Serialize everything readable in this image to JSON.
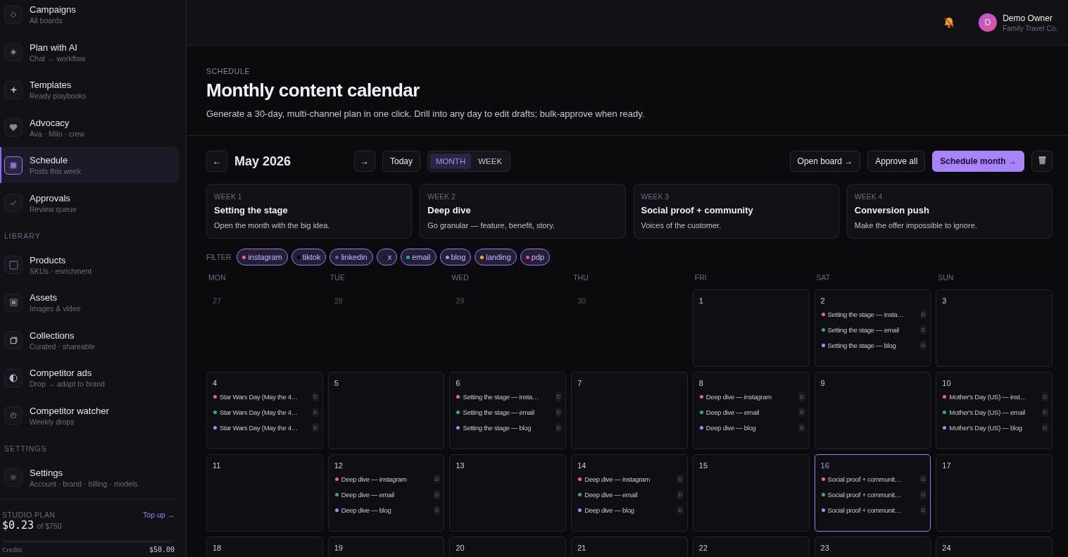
{
  "sidebar": {
    "groups": [
      {
        "items": [
          {
            "label": "Campaigns",
            "sub": "All boards",
            "selected": false
          },
          {
            "label": "Plan with AI",
            "sub": "Chat → workflow",
            "selected": false
          },
          {
            "label": "Templates",
            "sub": "Ready playbooks",
            "selected": false
          },
          {
            "label": "Advocacy",
            "sub": "Ava · Milo · crew",
            "selected": false
          },
          {
            "label": "Schedule",
            "sub": "Posts this week",
            "selected": true
          },
          {
            "label": "Approvals",
            "sub": "Review queue",
            "selected": false
          }
        ]
      },
      {
        "heading": "LIBRARY",
        "items": [
          {
            "label": "Products",
            "sub": "SKUs · enrichment",
            "selected": false
          },
          {
            "label": "Assets",
            "sub": "Images & video",
            "selected": false
          },
          {
            "label": "Collections",
            "sub": "Curated · shareable",
            "selected": false
          },
          {
            "label": "Competitor ads",
            "sub": "Drop → adapt to brand",
            "selected": false
          },
          {
            "label": "Competitor watcher",
            "sub": "Weekly drops",
            "selected": false
          }
        ]
      },
      {
        "heading": "SETTINGS",
        "items": [
          {
            "label": "Settings",
            "sub": "Account · brand · billing · models",
            "selected": false
          }
        ]
      }
    ],
    "plan": {
      "label": "STUDIO PLAN",
      "link": "Top up →",
      "amount": "$0.23",
      "of": "of $750",
      "level": 0.0003,
      "credits_label": "Credits",
      "credits_value": "$50.00"
    }
  },
  "topbar": {
    "user": {
      "initial": "D",
      "name": "Demo Owner",
      "org": "Family Travel Co."
    }
  },
  "header": {
    "eyebrow": "SCHEDULE",
    "title": "Monthly content calendar",
    "description": "Generate a 30-day, multi-channel plan in one click. Drill into any day to edit drafts; bulk-approve when ready."
  },
  "toolbar": {
    "prev": "←",
    "month": "May 2026",
    "next": "→",
    "today": "Today",
    "views": [
      {
        "label": "MONTH",
        "selected": true
      },
      {
        "label": "WEEK",
        "selected": false
      }
    ],
    "actions": [
      {
        "label": "Open board →",
        "kind": "secondary"
      },
      {
        "label": "Approve all",
        "kind": "secondary"
      },
      {
        "label": "Schedule month →",
        "kind": "primary"
      }
    ]
  },
  "weeks": [
    {
      "label": "WEEK 1",
      "title": "Setting the stage",
      "description": "Open the month with the big idea."
    },
    {
      "label": "WEEK 2",
      "title": "Deep dive",
      "description": "Go granular — feature, benefit, story."
    },
    {
      "label": "WEEK 3",
      "title": "Social proof + community",
      "description": "Voices of the customer."
    },
    {
      "label": "WEEK 4",
      "title": "Conversion push",
      "description": "Make the offer impossible to ignore."
    }
  ],
  "filter": {
    "label": "FILTER",
    "channels": [
      {
        "label": "instagram",
        "color": "#f0609a"
      },
      {
        "label": "tiktok",
        "color": "#050505"
      },
      {
        "label": "linkedin",
        "color": "#2f6fd0"
      },
      {
        "label": "x",
        "color": "#1c1c1c"
      },
      {
        "label": "email",
        "color": "#1fb57e"
      },
      {
        "label": "blog",
        "color": "#a78bfa"
      },
      {
        "label": "landing",
        "color": "#f5a524"
      },
      {
        "label": "pdp",
        "color": "#ec4f8a"
      }
    ]
  },
  "calendar": {
    "weekdays": [
      "MON",
      "TUE",
      "WED",
      "THU",
      "FRI",
      "SAT",
      "SUN"
    ],
    "weeks": [
      {
        "days": [
          {
            "day": "27",
            "outside": true,
            "selected": false
          },
          {
            "day": "28",
            "outside": true,
            "selected": false
          },
          {
            "day": "29",
            "outside": true,
            "selected": false
          },
          {
            "day": "30",
            "outside": true,
            "selected": false
          },
          {
            "day": "1",
            "outside": false,
            "selected": false
          },
          {
            "day": "2",
            "outside": false,
            "selected": false,
            "events": [
              {
                "title": "Setting the stage — insta…",
                "color": "#f0609a",
                "badge": "D"
              },
              {
                "title": "Setting the stage — email",
                "color": "#1fb57e",
                "badge": "D"
              },
              {
                "title": "Setting the stage — blog",
                "color": "#a78bfa",
                "badge": "D"
              }
            ]
          },
          {
            "day": "3",
            "outside": false,
            "selected": false
          }
        ]
      },
      {
        "days": [
          {
            "day": "4",
            "outside": false,
            "selected": false,
            "events": [
              {
                "title": "Star Wars Day (May the 4…",
                "color": "#f0609a",
                "badge": "D"
              },
              {
                "title": "Star Wars Day (May the 4…",
                "color": "#1fb57e",
                "badge": "D"
              },
              {
                "title": "Star Wars Day (May the 4…",
                "color": "#a78bfa",
                "badge": "D"
              }
            ]
          },
          {
            "day": "5",
            "outside": false,
            "selected": false
          },
          {
            "day": "6",
            "outside": false,
            "selected": false,
            "events": [
              {
                "title": "Setting the stage — insta…",
                "color": "#f0609a",
                "badge": "D"
              },
              {
                "title": "Setting the stage — email",
                "color": "#1fb57e",
                "badge": "D"
              },
              {
                "title": "Setting the stage — blog",
                "color": "#a78bfa",
                "badge": "D"
              }
            ]
          },
          {
            "day": "7",
            "outside": false,
            "selected": false
          },
          {
            "day": "8",
            "outside": false,
            "selected": false,
            "events": [
              {
                "title": "Deep dive — instagram",
                "color": "#f0609a",
                "badge": "D"
              },
              {
                "title": "Deep dive — email",
                "color": "#1fb57e",
                "badge": "D"
              },
              {
                "title": "Deep dive — blog",
                "color": "#a78bfa",
                "badge": "D"
              }
            ]
          },
          {
            "day": "9",
            "outside": false,
            "selected": false
          },
          {
            "day": "10",
            "outside": false,
            "selected": false,
            "events": [
              {
                "title": "Mother's Day (US) — inst…",
                "color": "#f0609a",
                "badge": "D"
              },
              {
                "title": "Mother's Day (US) — email",
                "color": "#1fb57e",
                "badge": "D"
              },
              {
                "title": "Mother's Day (US) — blog",
                "color": "#a78bfa",
                "badge": "D"
              }
            ]
          }
        ]
      },
      {
        "days": [
          {
            "day": "11",
            "outside": false,
            "selected": false
          },
          {
            "day": "12",
            "outside": false,
            "selected": false,
            "events": [
              {
                "title": "Deep dive — instagram",
                "color": "#f0609a",
                "badge": "D"
              },
              {
                "title": "Deep dive — email",
                "color": "#1fb57e",
                "badge": "D"
              },
              {
                "title": "Deep dive — blog",
                "color": "#a78bfa",
                "badge": "D"
              }
            ]
          },
          {
            "day": "13",
            "outside": false,
            "selected": false
          },
          {
            "day": "14",
            "outside": false,
            "selected": false,
            "events": [
              {
                "title": "Deep dive — instagram",
                "color": "#f0609a",
                "badge": "D"
              },
              {
                "title": "Deep dive — email",
                "color": "#1fb57e",
                "badge": "D"
              },
              {
                "title": "Deep dive — blog",
                "color": "#a78bfa",
                "badge": "D"
              }
            ]
          },
          {
            "day": "15",
            "outside": false,
            "selected": false
          },
          {
            "day": "16",
            "outside": false,
            "selected": true,
            "events": [
              {
                "title": "Social proof + communit…",
                "color": "#f0609a",
                "badge": "D"
              },
              {
                "title": "Social proof + communit…",
                "color": "#1fb57e",
                "badge": "D"
              },
              {
                "title": "Social proof + communit…",
                "color": "#a78bfa",
                "badge": "D"
              }
            ]
          },
          {
            "day": "17",
            "outside": false,
            "selected": false
          }
        ]
      },
      {
        "days": [
          {
            "day": "18",
            "outside": false,
            "selected": false
          },
          {
            "day": "19",
            "outside": false,
            "selected": false
          },
          {
            "day": "20",
            "outside": false,
            "selected": false
          },
          {
            "day": "21",
            "outside": false,
            "selected": false
          },
          {
            "day": "22",
            "outside": false,
            "selected": false
          },
          {
            "day": "23",
            "outside": false,
            "selected": false
          },
          {
            "day": "24",
            "outside": false,
            "selected": false
          }
        ]
      }
    ]
  }
}
